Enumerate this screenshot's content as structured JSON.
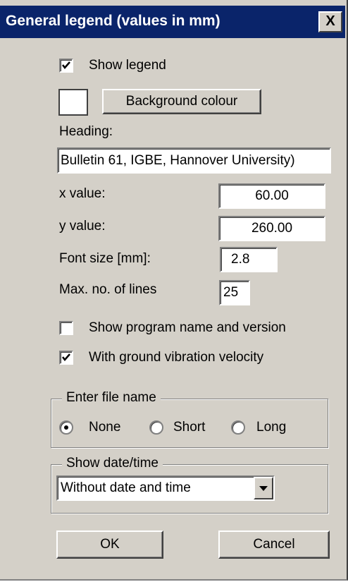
{
  "title": "General legend (values in mm)",
  "close_label": "X",
  "show_legend": {
    "label": "Show legend",
    "checked": true
  },
  "background": {
    "button_label": "Background colour",
    "swatch_color": "#ffffff"
  },
  "heading": {
    "label": "Heading:",
    "value": "Bulletin 61, IGBE, Hannover University)"
  },
  "x_value": {
    "label": "x value:",
    "value": "60.00"
  },
  "y_value": {
    "label": "y value:",
    "value": "260.00"
  },
  "font_size": {
    "label": "Font size [mm]:",
    "value": "2.8"
  },
  "max_lines": {
    "label": "Max. no. of lines",
    "value": "25"
  },
  "show_program": {
    "label": "Show program name and version",
    "checked": false
  },
  "ground_vibration": {
    "label": "With ground vibration velocity",
    "checked": true
  },
  "file_name_group": {
    "legend": "Enter file name",
    "options": [
      "None",
      "Short",
      "Long"
    ],
    "selected": "None"
  },
  "date_time_group": {
    "legend": "Show date/time",
    "selected": "Without date and time",
    "arrow_icon": "chevron-down-icon"
  },
  "buttons": {
    "ok": "OK",
    "cancel": "Cancel"
  },
  "colors": {
    "title_bar": "#0a246a",
    "dialog_bg": "#d4d0c8"
  }
}
